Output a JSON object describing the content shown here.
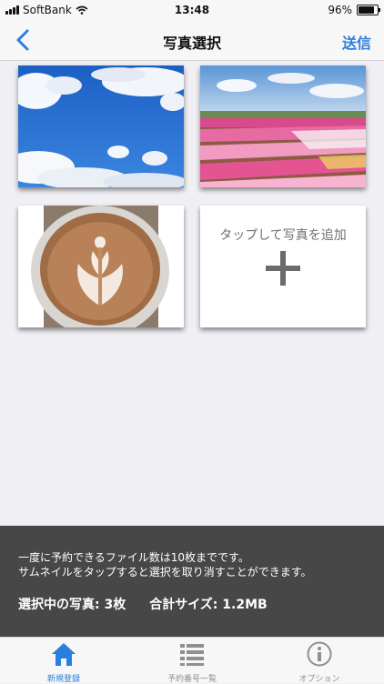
{
  "status_bar": {
    "carrier": "SoftBank",
    "time": "13:48",
    "battery_percent": "96%",
    "battery_level": 0.96
  },
  "navbar": {
    "title": "写真選択",
    "send_label": "送信",
    "back_icon": "chevron-left-icon"
  },
  "photos": [
    {
      "subject": "blue sky with clouds"
    },
    {
      "subject": "flower field"
    },
    {
      "subject": "latte art coffee"
    }
  ],
  "add_tile": {
    "label": "タップして写真を追加",
    "icon": "plus-icon"
  },
  "info": {
    "line1": "一度に予約できるファイル数は10枚までです。",
    "line2": "サムネイルをタップすると選択を取り消すことができます。",
    "selected_count": "選択中の写真: 3枚",
    "total_size": "合計サイズ: 1.2MB"
  },
  "tabs": [
    {
      "label": "新規登録",
      "icon": "home-icon",
      "active": true
    },
    {
      "label": "予約番号一覧",
      "icon": "list-icon",
      "active": false
    },
    {
      "label": "オプション",
      "icon": "info-icon",
      "active": false
    }
  ],
  "colors": {
    "accent": "#2a7fde",
    "panel": "#474747",
    "background": "#efeff4"
  }
}
